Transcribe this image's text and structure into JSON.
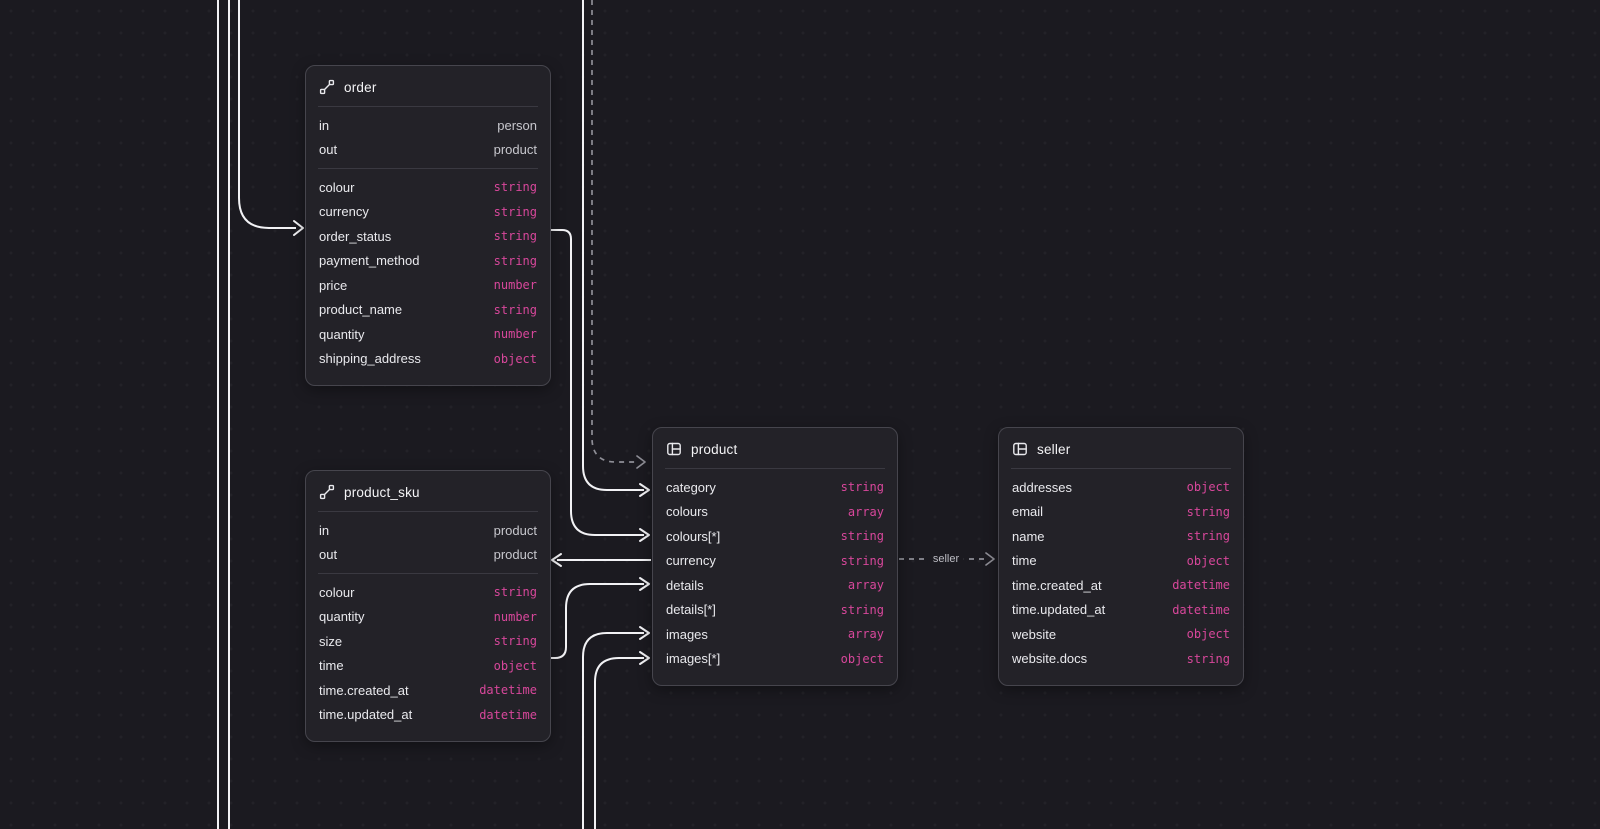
{
  "colors": {
    "background": "#1b1a20",
    "card_background": "#232228",
    "card_border": "#46454d",
    "type_pink": "#d8479b",
    "solid_edge": "#f2f2f5",
    "dashed_edge": "#8e8e96"
  },
  "canvas": {
    "edge_label": "seller"
  },
  "tables": [
    {
      "id": "order",
      "title": "order",
      "icon": "relation-icon",
      "links": [
        {
          "name": "in",
          "value": "person"
        },
        {
          "name": "out",
          "value": "product"
        }
      ],
      "fields": [
        {
          "name": "colour",
          "type": "string"
        },
        {
          "name": "currency",
          "type": "string"
        },
        {
          "name": "order_status",
          "type": "string"
        },
        {
          "name": "payment_method",
          "type": "string"
        },
        {
          "name": "price",
          "type": "number"
        },
        {
          "name": "product_name",
          "type": "string"
        },
        {
          "name": "quantity",
          "type": "number"
        },
        {
          "name": "shipping_address",
          "type": "object"
        }
      ]
    },
    {
      "id": "product_sku",
      "title": "product_sku",
      "icon": "relation-icon",
      "links": [
        {
          "name": "in",
          "value": "product"
        },
        {
          "name": "out",
          "value": "product"
        }
      ],
      "fields": [
        {
          "name": "colour",
          "type": "string"
        },
        {
          "name": "quantity",
          "type": "number"
        },
        {
          "name": "size",
          "type": "string"
        },
        {
          "name": "time",
          "type": "object"
        },
        {
          "name": "time.created_at",
          "type": "datetime"
        },
        {
          "name": "time.updated_at",
          "type": "datetime"
        }
      ]
    },
    {
      "id": "product",
      "title": "product",
      "icon": "table-icon",
      "links": [],
      "fields": [
        {
          "name": "category",
          "type": "string"
        },
        {
          "name": "colours",
          "type": "array"
        },
        {
          "name": "colours[*]",
          "type": "string"
        },
        {
          "name": "currency",
          "type": "string"
        },
        {
          "name": "details",
          "type": "array"
        },
        {
          "name": "details[*]",
          "type": "string"
        },
        {
          "name": "images",
          "type": "array"
        },
        {
          "name": "images[*]",
          "type": "object"
        }
      ]
    },
    {
      "id": "seller",
      "title": "seller",
      "icon": "table-icon",
      "links": [],
      "fields": [
        {
          "name": "addresses",
          "type": "object"
        },
        {
          "name": "email",
          "type": "string"
        },
        {
          "name": "name",
          "type": "string"
        },
        {
          "name": "time",
          "type": "object"
        },
        {
          "name": "time.created_at",
          "type": "datetime"
        },
        {
          "name": "time.updated_at",
          "type": "datetime"
        },
        {
          "name": "website",
          "type": "object"
        },
        {
          "name": "website.docs",
          "type": "string"
        }
      ]
    }
  ]
}
